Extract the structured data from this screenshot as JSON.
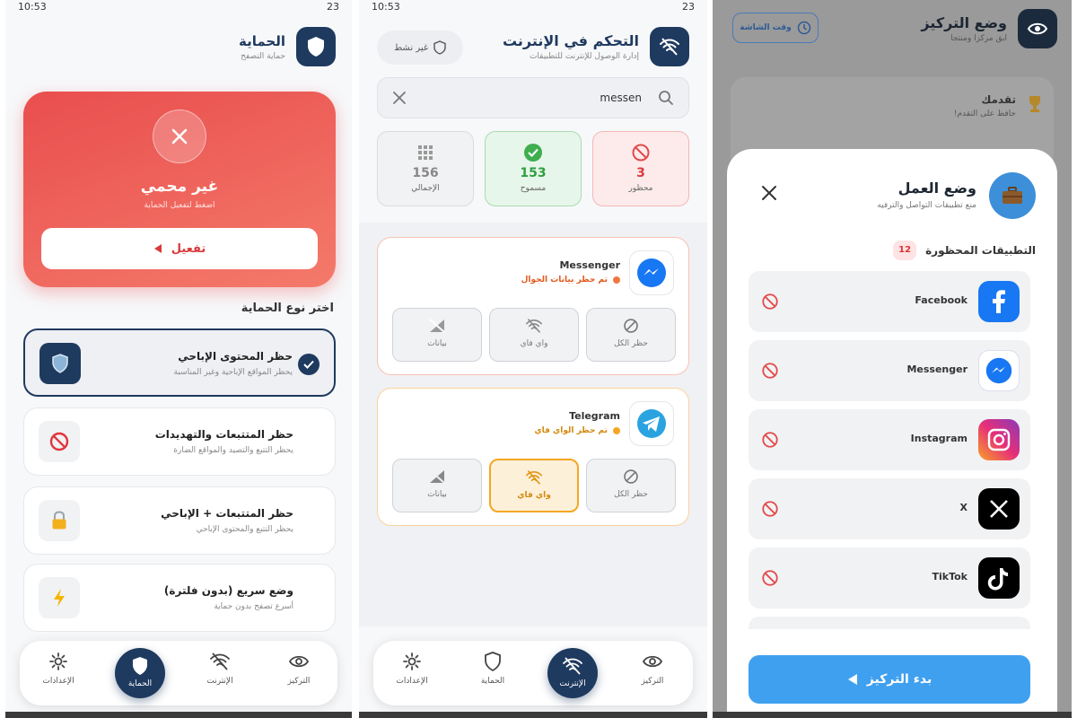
{
  "status_bar": {
    "time": "10:53",
    "battery": "23"
  },
  "panel1": {
    "header": {
      "title": "الحماية",
      "subtitle": "حماية التصفح",
      "icon": "shield-icon"
    },
    "hero": {
      "status": "غير محمي",
      "hint": "اضغط لتفعيل الحماية",
      "button_label": "تفعيل",
      "color": "#e94e4e"
    },
    "section_title": "اختر نوع الحماية",
    "options": [
      {
        "title": "حظر المحتوى الإباحي",
        "subtitle": "يحظر المواقع الإباحية وغير المناسبة",
        "icon": "shield-emoji-icon",
        "selected": true
      },
      {
        "title": "حظر المتتبعات والتهديدات",
        "subtitle": "يحظر التتبع والتصيد والمواقع الضارة",
        "icon": "no-entry-icon",
        "selected": false
      },
      {
        "title": "حظر المتتبعات + الإباحي",
        "subtitle": "يحظر التتبع والمحتوى الإباحي",
        "icon": "lock-icon",
        "selected": false
      },
      {
        "title": "وضع سريع (بدون فلترة)",
        "subtitle": "أسرع تصفح بدون حماية",
        "icon": "lightning-icon",
        "selected": false
      }
    ],
    "nav": {
      "settings": "الإعدادات",
      "protection": "الحماية",
      "internet": "الإنترنت",
      "focus": "التركيز",
      "active": "protection"
    }
  },
  "panel2": {
    "header": {
      "title": "التحكم في الإنترنت",
      "subtitle": "إدارة الوصول للإنترنت للتطبيقات",
      "status_pill": "غير نشط"
    },
    "search": {
      "value": "messen"
    },
    "stats": [
      {
        "value": "3",
        "label": "محظور",
        "color": "#e24a4a"
      },
      {
        "value": "153",
        "label": "مسموح",
        "color": "#3fae4f"
      },
      {
        "value": "156",
        "label": "الإجمالي",
        "color": "#888888"
      }
    ],
    "apps": [
      {
        "name": "Messenger",
        "status": "تم حظر بيانات الجوال",
        "status_color": "#f0773f",
        "controls": [
          "حظر الكل",
          "واي فاي",
          "بيانات"
        ],
        "active": "data"
      },
      {
        "name": "Telegram",
        "status": "تم حظر الواي فاي",
        "status_color": "#f5a623",
        "controls": [
          "حظر الكل",
          "واي فاي",
          "بيانات"
        ],
        "active": "wifi"
      }
    ],
    "nav": {
      "settings": "الإعدادات",
      "protection": "الحماية",
      "internet": "الإنترنت",
      "focus": "التركيز",
      "active": "internet"
    }
  },
  "panel3": {
    "header": {
      "title": "وضع التركيز",
      "subtitle": "ابق مركزا ومنتجا",
      "screen_time": "وقت الشاشة"
    },
    "progress": {
      "title": "تقدمك",
      "subtitle": "حافظ على التقدم!"
    },
    "sheet": {
      "title": "وضع العمل",
      "subtitle": "منع تطبيقات التواصل والترفيه",
      "blocked_title": "التطبيقات المحظورة",
      "blocked_count": "12",
      "apps": [
        "Facebook",
        "Messenger",
        "Instagram",
        "X",
        "TikTok"
      ],
      "start_label": "بدء التركيز"
    }
  }
}
